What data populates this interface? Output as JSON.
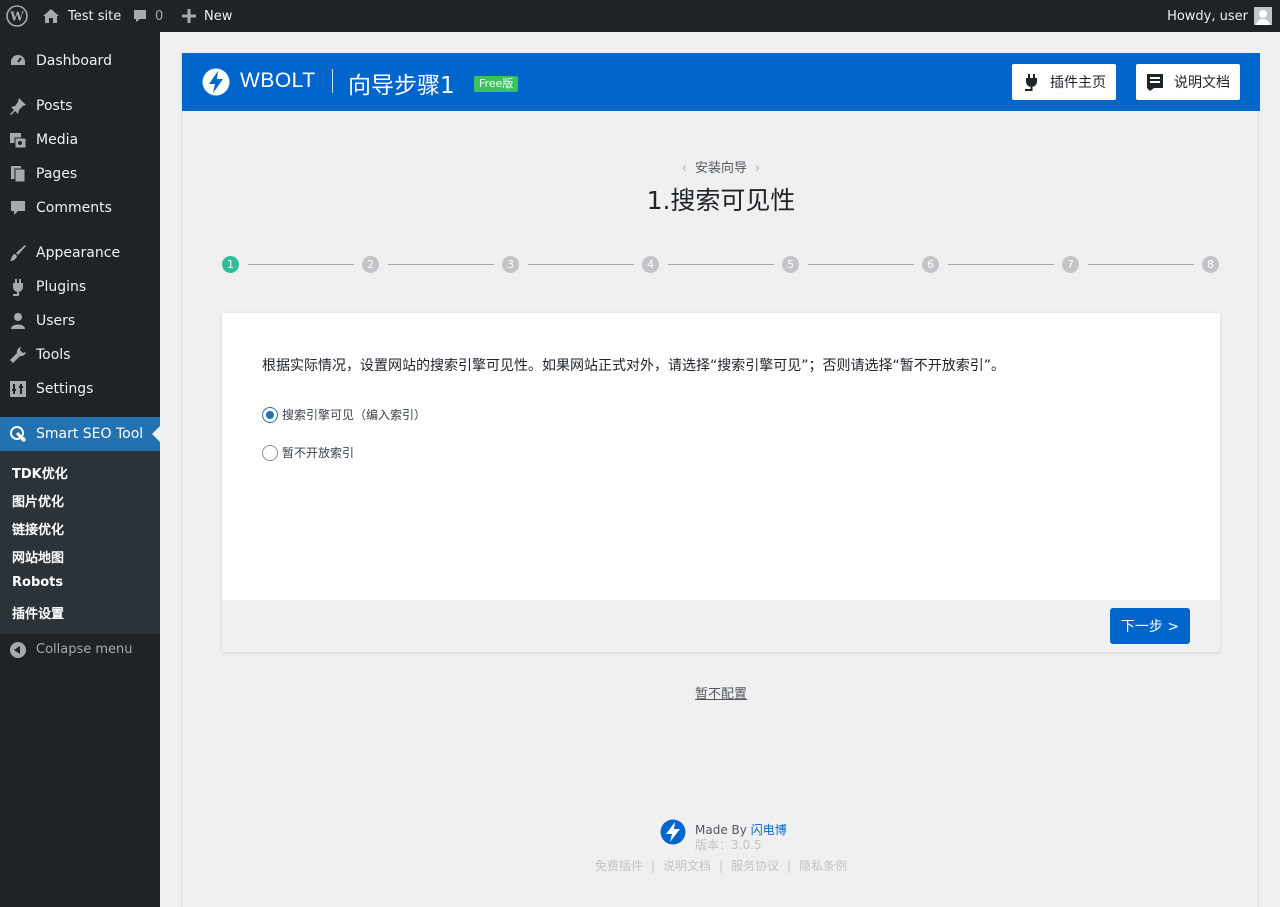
{
  "admin_bar": {
    "site_name": "Test site",
    "comments_count": "0",
    "new_label": "New",
    "howdy": "Howdy, user"
  },
  "sidebar": {
    "items": [
      {
        "label": "Dashboard",
        "icon": "dashboard-icon"
      },
      {
        "label": "Posts",
        "icon": "pushpin-icon"
      },
      {
        "label": "Media",
        "icon": "media-icon"
      },
      {
        "label": "Pages",
        "icon": "pages-icon"
      },
      {
        "label": "Comments",
        "icon": "comment-icon"
      },
      {
        "label": "Appearance",
        "icon": "paintbrush-icon"
      },
      {
        "label": "Plugins",
        "icon": "plugin-icon"
      },
      {
        "label": "Users",
        "icon": "user-icon"
      },
      {
        "label": "Tools",
        "icon": "wrench-icon"
      },
      {
        "label": "Settings",
        "icon": "settings-icon"
      },
      {
        "label": "Smart SEO Tool",
        "icon": "seo-icon"
      }
    ],
    "submenu": [
      "TDK优化",
      "图片优化",
      "链接优化",
      "网站地图",
      "Robots",
      "插件设置"
    ],
    "collapse_label": "Collapse menu"
  },
  "plugin_header": {
    "brand": "WBOLT",
    "title": "向导步骤1",
    "badge": "Free版",
    "home_button": "插件主页",
    "docs_button": "说明文档",
    "brand_color": "#0066cc"
  },
  "wizard": {
    "crumb": "安装向导",
    "step_title": "1.搜索可见性",
    "steps": [
      "1",
      "2",
      "3",
      "4",
      "5",
      "6",
      "7",
      "8"
    ],
    "active_step": 1,
    "description": "根据实际情况，设置网站的搜索引擎可见性。如果网站正式对外，请选择“搜索引擎可见”；否则请选择“暂不开放索引”。",
    "options": [
      {
        "label": "搜索引擎可见（编入索引）",
        "checked": true
      },
      {
        "label": "暂不开放索引",
        "checked": false
      }
    ],
    "next_button": "下一步 >",
    "skip_link": "暂不配置"
  },
  "footer": {
    "made_by": "Made By",
    "author": "闪电博",
    "version": "版本：3.0.5",
    "links": [
      "免费插件",
      "说明文档",
      "服务协议",
      "隐私条例"
    ]
  }
}
